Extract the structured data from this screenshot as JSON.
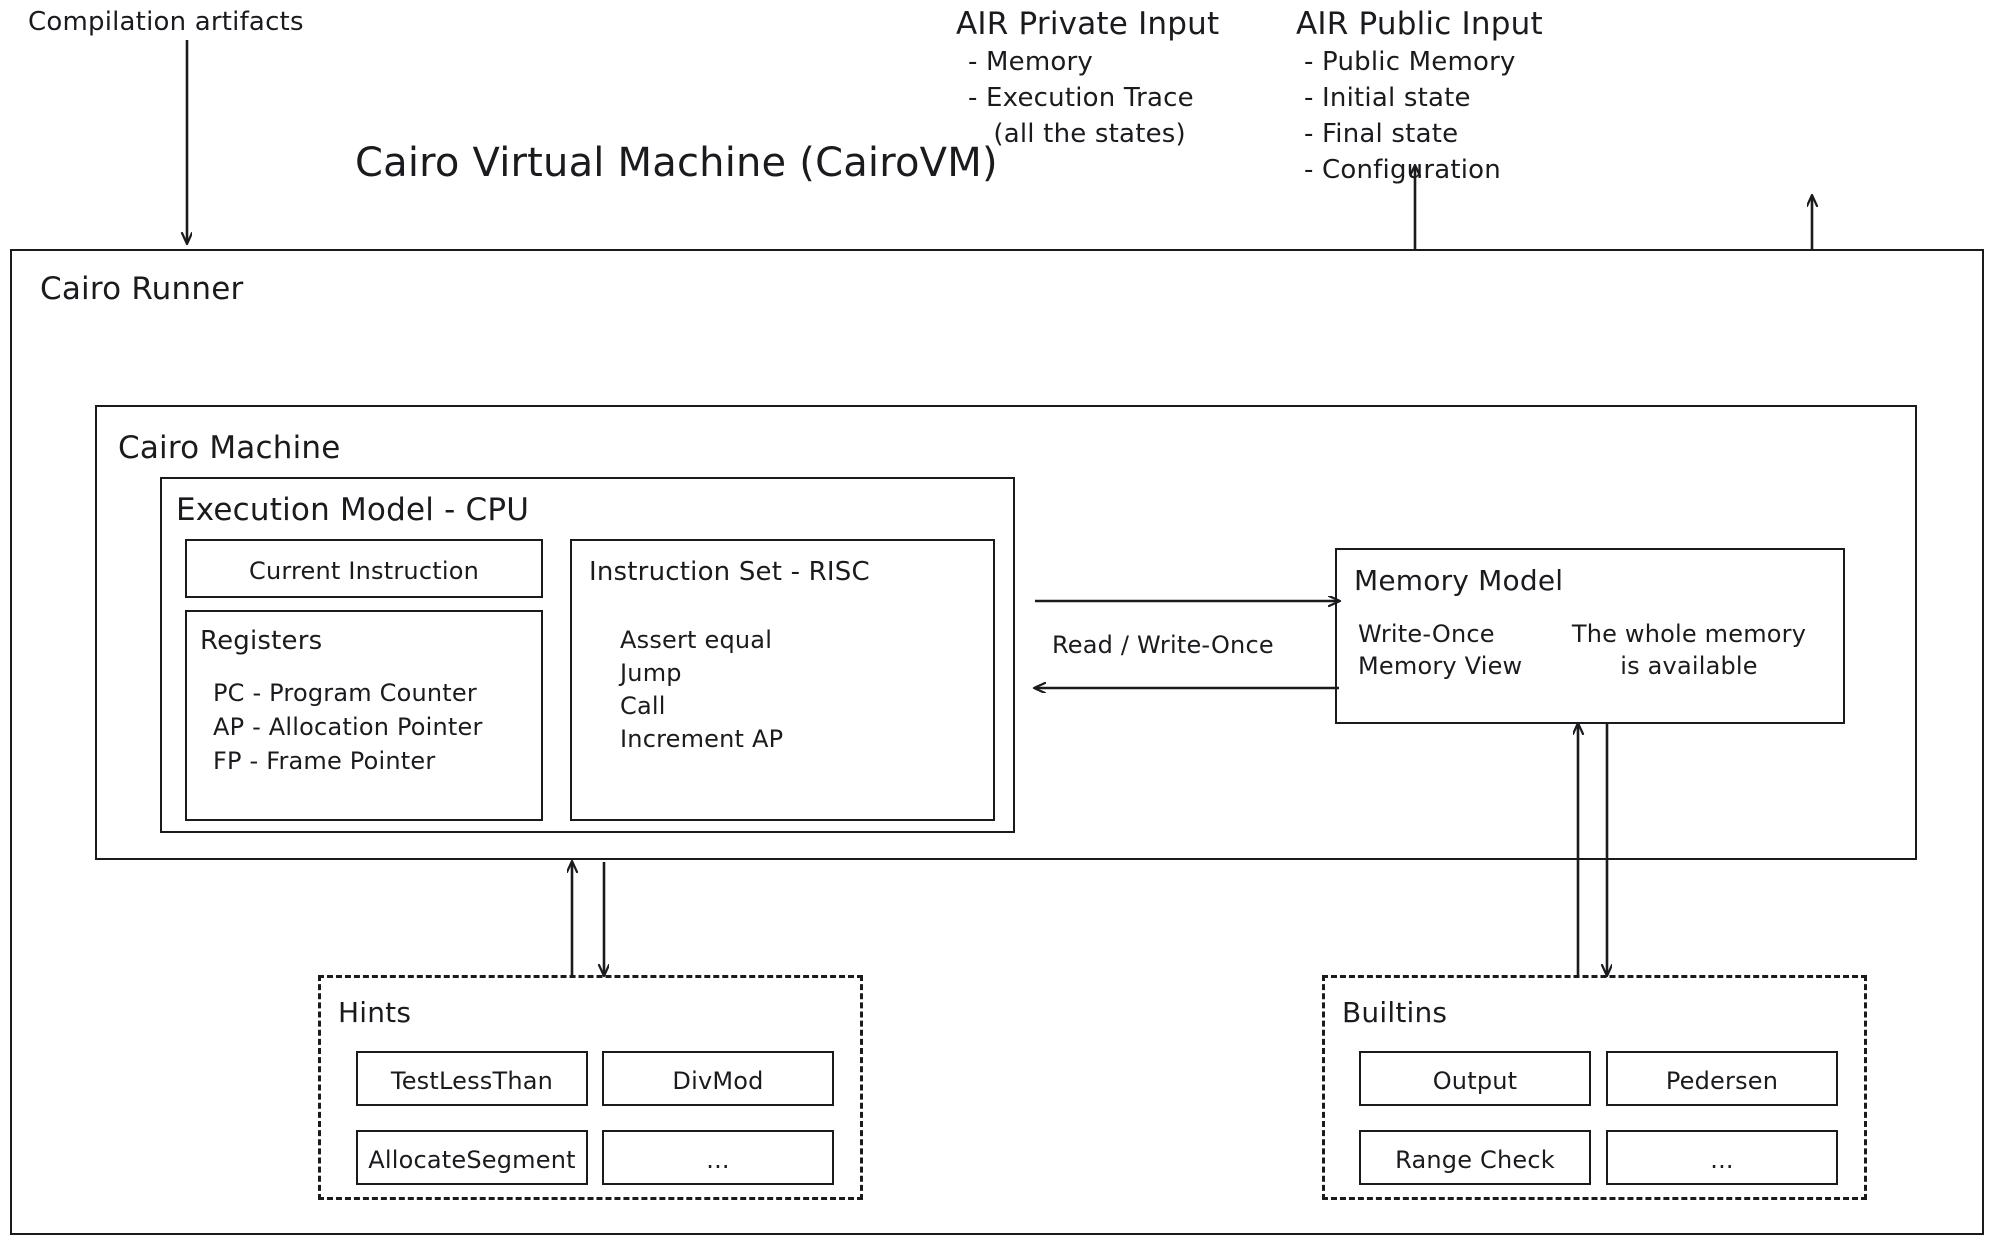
{
  "diagram": {
    "title": "Cairo Virtual Machine (CairoVM)",
    "input_label": "Compilation artifacts",
    "air_private": {
      "heading": "AIR Private Input",
      "lines": [
        "- Memory",
        "- Execution Trace",
        "   (all the states)"
      ]
    },
    "air_public": {
      "heading": "AIR Public Input",
      "lines": [
        "- Public Memory",
        "- Initial state",
        "- Final state",
        "- Configuration"
      ]
    },
    "runner": {
      "label": "Cairo Runner"
    },
    "machine": {
      "label": "Cairo Machine"
    },
    "cpu": {
      "label": "Execution Model - CPU",
      "current_instruction": "Current Instruction",
      "registers": {
        "heading": "Registers",
        "items": [
          "PC - Program Counter",
          "AP - Allocation Pointer",
          "FP - Frame Pointer"
        ]
      },
      "instruction_set": {
        "heading": "Instruction Set - RISC",
        "items": [
          "Assert equal",
          "Jump",
          "Call",
          "Increment AP"
        ]
      }
    },
    "memory_model": {
      "label": "Memory Model",
      "left_note": "Write-Once\nMemory View",
      "right_note": "The whole memory\nis available"
    },
    "cpu_memory_link": {
      "label": "Read / Write-Once"
    },
    "hints": {
      "label": "Hints",
      "items": [
        "TestLessThan",
        "DivMod",
        "AllocateSegment",
        "..."
      ]
    },
    "builtins": {
      "label": "Builtins",
      "items": [
        "Output",
        "Pedersen",
        "Range Check",
        "..."
      ]
    },
    "colors": {
      "stroke": "#1b1b1f",
      "background": "#ffffff"
    }
  }
}
